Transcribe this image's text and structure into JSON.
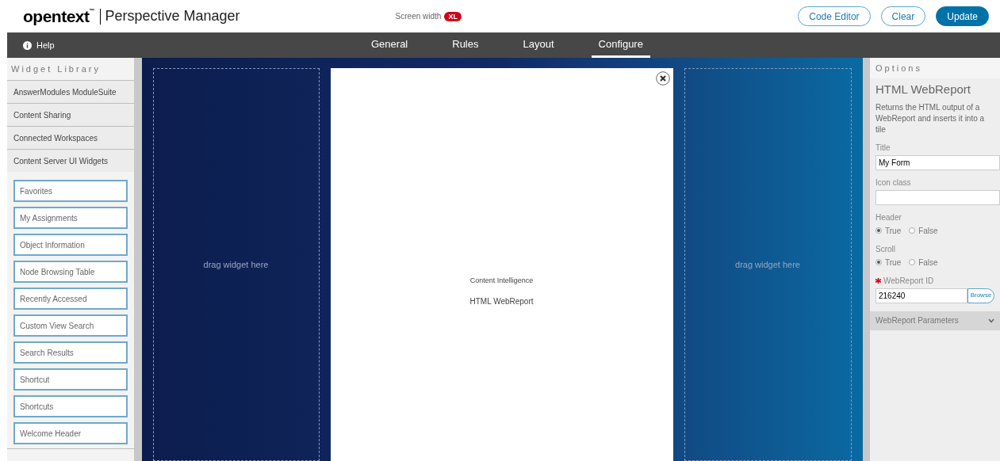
{
  "header": {
    "logo": "opentext",
    "trademark": "™",
    "title": "Perspective Manager",
    "screen_width": {
      "label": "Screen width",
      "badge": "XL"
    },
    "buttons": [
      {
        "label": "Code Editor",
        "kind": "outline"
      },
      {
        "label": "Clear",
        "kind": "outline"
      },
      {
        "label": "Update",
        "kind": "primary"
      }
    ]
  },
  "nav": {
    "help": "Help",
    "tabs": [
      {
        "label": "General",
        "selected": false
      },
      {
        "label": "Rules",
        "selected": false
      },
      {
        "label": "Layout",
        "selected": false
      },
      {
        "label": "Configure",
        "selected": true
      }
    ]
  },
  "widget_library": {
    "title": "Widget Library",
    "groups": [
      {
        "label": "AnswerModules ModuleSuite"
      },
      {
        "label": "Content Sharing"
      },
      {
        "label": "Connected Workspaces"
      },
      {
        "label": "Content Server UI Widgets",
        "children": [
          "Favorites",
          "My Assignments",
          "Object Information",
          "Node Browsing Table",
          "Recently Accessed",
          "Custom View Search",
          "Search Results",
          "Shortcut",
          "Shortcuts",
          "Welcome Header"
        ]
      }
    ]
  },
  "canvas": {
    "slots": [
      {
        "kind": "drop",
        "label": "drag widget here"
      },
      {
        "kind": "tile",
        "category": "Content Intelligence",
        "label": "HTML WebReport"
      },
      {
        "kind": "drop",
        "label": "drag widget here"
      }
    ]
  },
  "options": {
    "title": "Options",
    "widget_title": "HTML WebReport",
    "description": "Returns the HTML output of a WebReport and inserts it into a tile",
    "fields": [
      {
        "kind": "text",
        "label": "Title",
        "value": "My Form"
      },
      {
        "kind": "text",
        "label": "Icon class"
      },
      {
        "kind": "radio",
        "label": "Header",
        "options": [
          {
            "label": "True",
            "selected": true
          },
          {
            "label": "False",
            "selected": false
          }
        ]
      },
      {
        "kind": "radio",
        "label": "Scroll",
        "options": [
          {
            "label": "True",
            "selected": true
          },
          {
            "label": "False",
            "selected": false
          }
        ]
      },
      {
        "kind": "browse",
        "label": "WebReport ID",
        "required": true,
        "value": "216240",
        "button": "Browse"
      }
    ],
    "section": {
      "label": "WebReport Parameters",
      "expanded": false
    }
  }
}
